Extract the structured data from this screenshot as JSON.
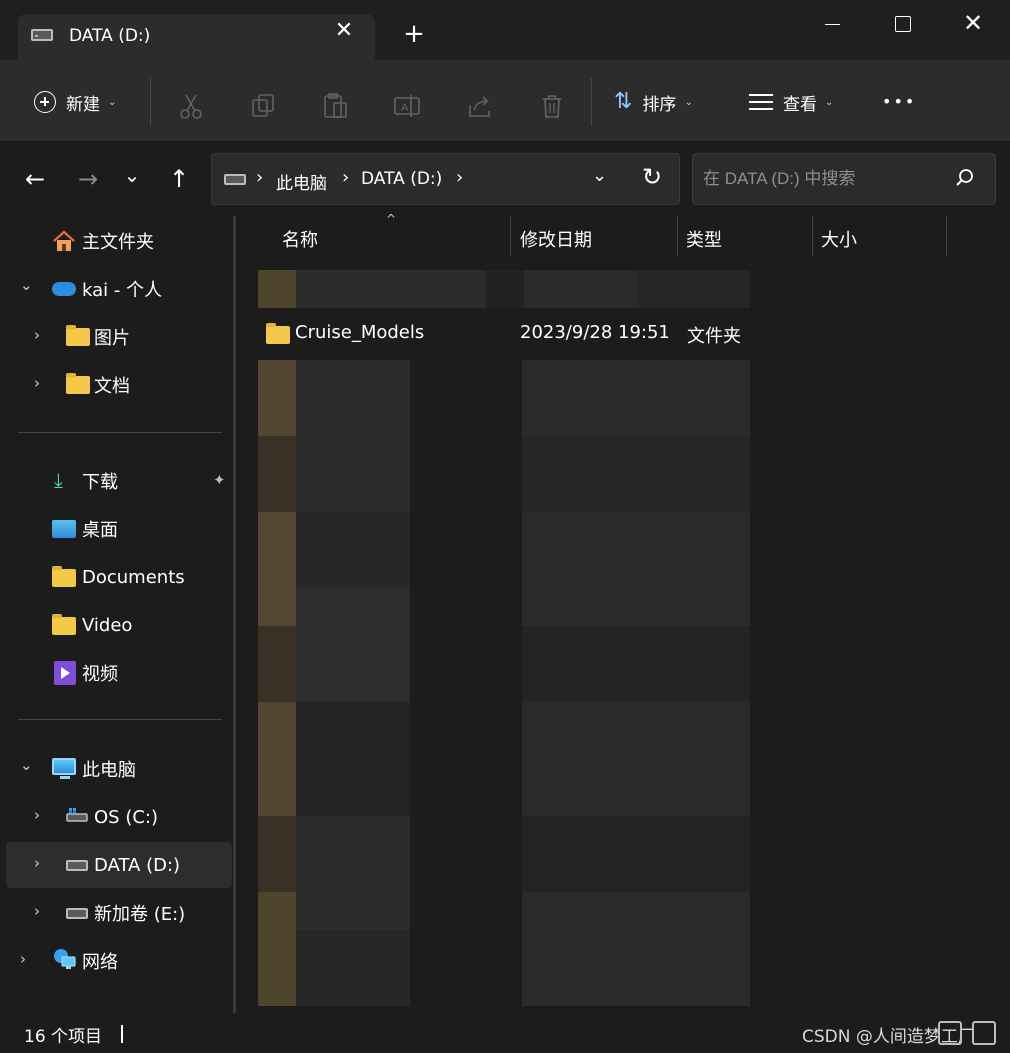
{
  "window": {
    "tab_title": "DATA (D:)",
    "tab_close": "✕",
    "new_tab": "+",
    "close_glyph": "✕"
  },
  "toolbar": {
    "new_label": "新建",
    "sort_label": "排序",
    "view_label": "查看",
    "more_glyph": "•••",
    "disabled_icons": [
      "cut-icon",
      "copy-icon",
      "paste-icon",
      "rename-icon",
      "share-icon",
      "delete-icon"
    ]
  },
  "nav": {
    "back": "←",
    "forward": "→",
    "recent": "⌄",
    "up": "↑",
    "breadcrumb": [
      "此电脑",
      "DATA (D:)"
    ],
    "breadcrumb_sep": "›",
    "dropdown": "⌄",
    "refresh": "↻"
  },
  "search": {
    "placeholder": "在 DATA (D:) 中搜索"
  },
  "sidebar": {
    "home": "主文件夹",
    "onedrive": "kai - 个人",
    "pictures": "图片",
    "documents_cn": "文档",
    "downloads": "下载",
    "desktop": "桌面",
    "documents": "Documents",
    "video": "Video",
    "videos_cn": "视频",
    "this_pc": "此电脑",
    "os_c": "OS (C:)",
    "data_d": "DATA (D:)",
    "new_vol_e": "新加卷 (E:)",
    "network": "网络",
    "chevron_right": "›",
    "chevron_down": "⌄",
    "pin_glyph": "📌"
  },
  "columns": {
    "name": "名称",
    "modified": "修改日期",
    "type": "类型",
    "size": "大小",
    "sort_caret": "^"
  },
  "files": [
    {
      "name": "Cruise_Models",
      "modified": "2023/9/28 19:51",
      "type": "文件夹",
      "size": ""
    }
  ],
  "status": {
    "item_count": "16 个项目"
  },
  "watermark": "CSDN @人间造梦工厂",
  "colors": {
    "background": "#1c1c1c",
    "toolbar": "#2c2c2c",
    "selected": "#2d2d2d",
    "folder": "#f4c84a",
    "accent": "#8fc8ff"
  }
}
